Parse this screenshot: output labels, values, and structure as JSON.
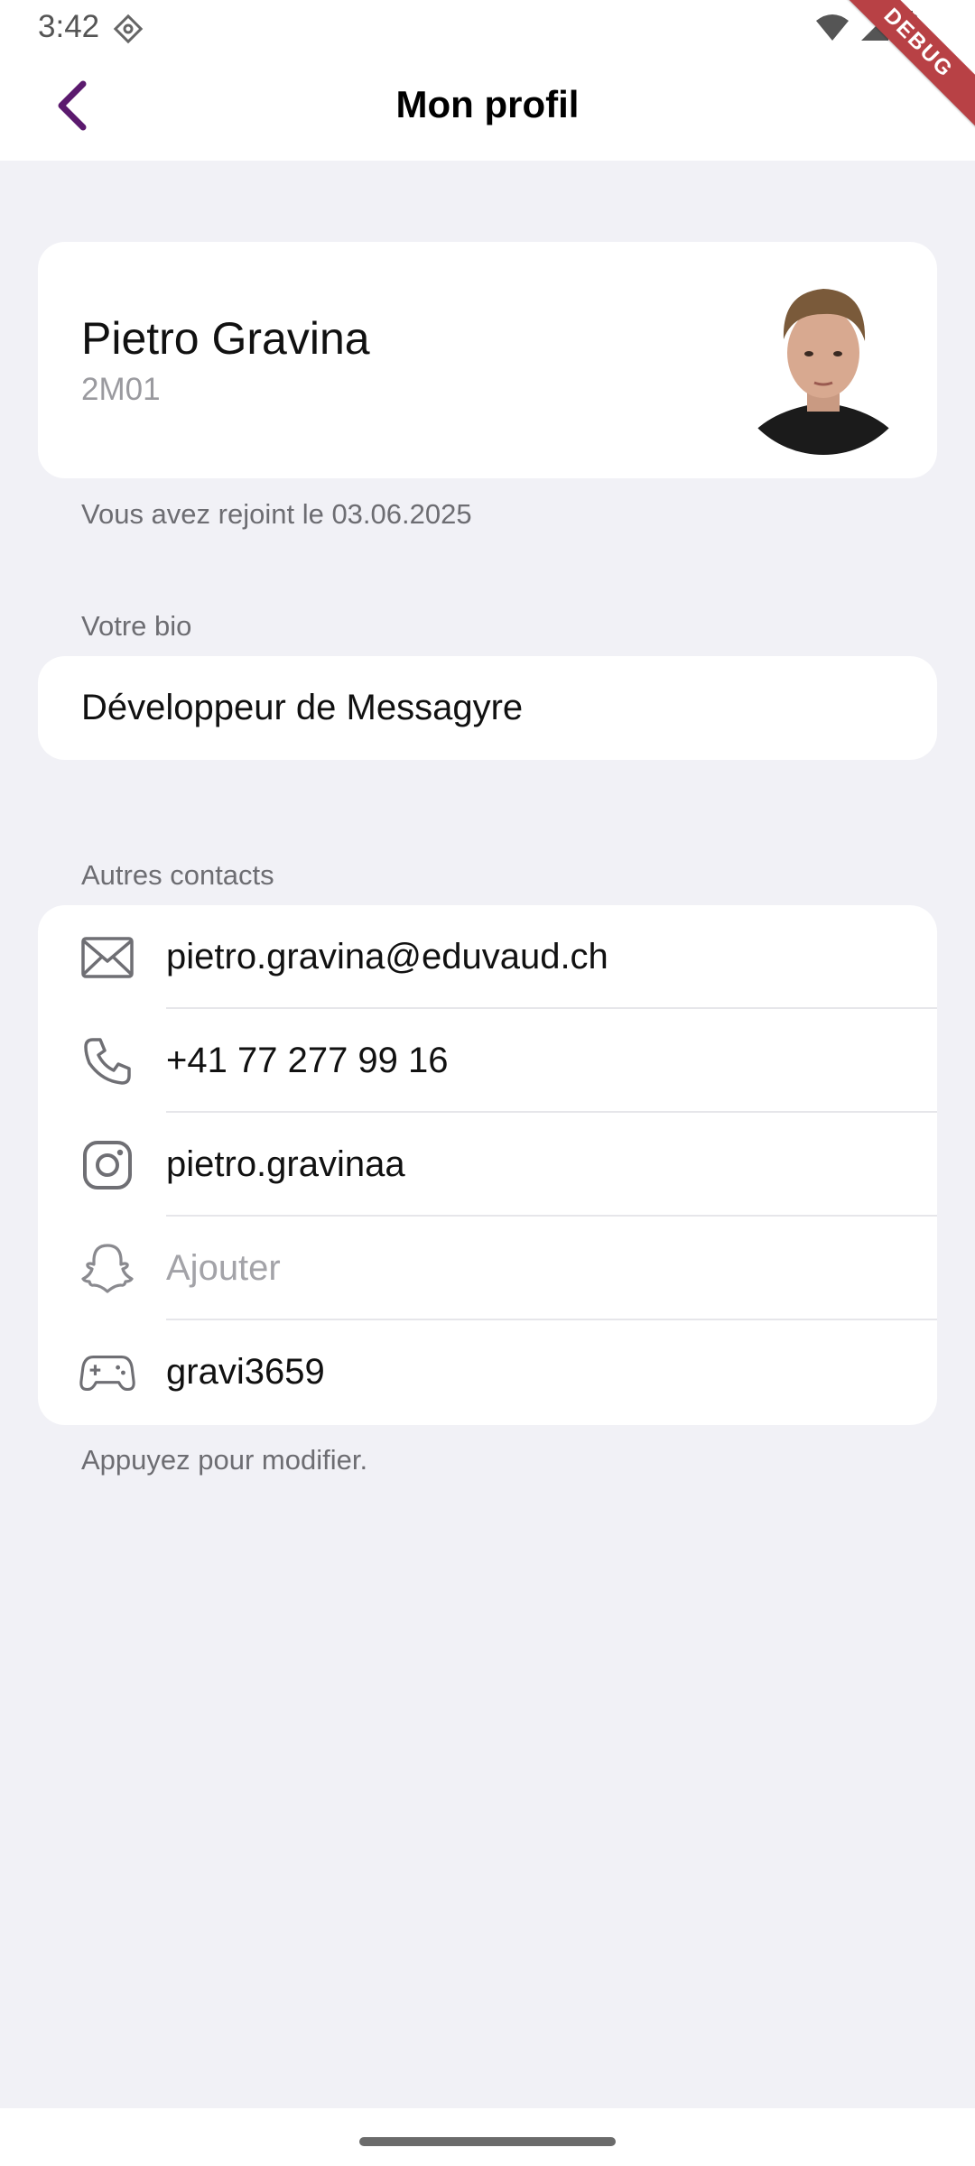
{
  "status_bar": {
    "time": "3:42",
    "debug_label": "DEBUG"
  },
  "header": {
    "title": "Mon profil",
    "accent_color": "#5b1a6e"
  },
  "profile": {
    "name": "Pietro Gravina",
    "class_code": "2M01",
    "joined_text": "Vous avez rejoint le 03.06.2025"
  },
  "bio": {
    "label": "Votre bio",
    "text": "Développeur de Messagyre"
  },
  "contacts": {
    "label": "Autres contacts",
    "items": [
      {
        "icon": "mail-icon",
        "value": "pietro.gravina@eduvaud.ch",
        "placeholder": false
      },
      {
        "icon": "phone-icon",
        "value": "+41 77 277 99 16",
        "placeholder": false
      },
      {
        "icon": "instagram-icon",
        "value": "pietro.gravinaa",
        "placeholder": false
      },
      {
        "icon": "snapchat-icon",
        "value": "Ajouter",
        "placeholder": true
      },
      {
        "icon": "gamepad-icon",
        "value": "gravi3659",
        "placeholder": false
      }
    ],
    "hint": "Appuyez pour modifier."
  }
}
